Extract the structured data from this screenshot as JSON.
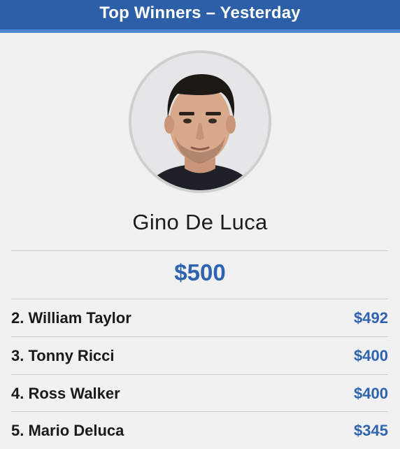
{
  "header": {
    "title": "Top Winners – Yesterday"
  },
  "winner": {
    "name": "Gino De Luca",
    "amount": "$500",
    "avatar_icon": "profile-photo"
  },
  "ranking": [
    {
      "label": "2. William Taylor",
      "amount": "$492"
    },
    {
      "label": "3. Tonny Ricci",
      "amount": "$400"
    },
    {
      "label": "4. Ross Walker",
      "amount": "$400"
    },
    {
      "label": "5. Mario Deluca",
      "amount": "$345"
    }
  ],
  "colors": {
    "header_bg": "#2c5fa8",
    "header_stripe": "#4b86d3",
    "accent": "#2e63b0",
    "background": "#f1f1f1"
  }
}
